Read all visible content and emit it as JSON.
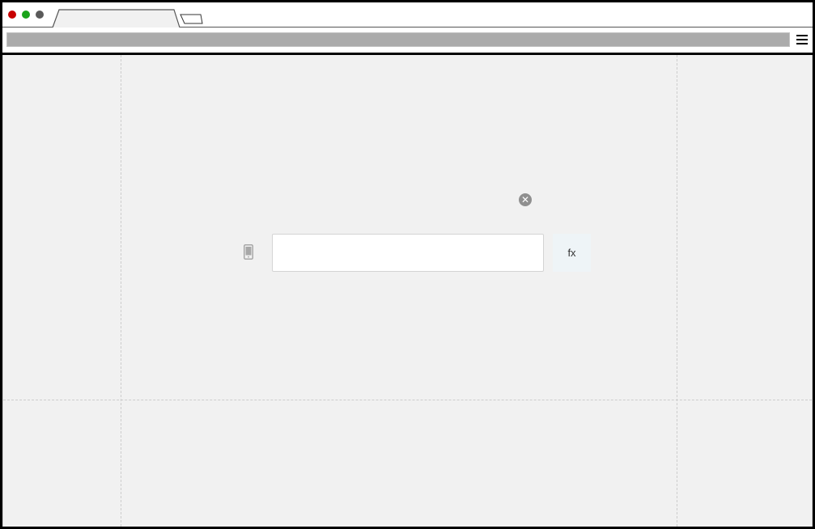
{
  "browser": {
    "active_tab_label": "",
    "new_tab_label": "",
    "address": ""
  },
  "field": {
    "value": "",
    "placeholder": "",
    "leading_icon": "mobile-phone-icon",
    "clear_icon": "close-circle-icon",
    "fx_label": "fx"
  },
  "colors": {
    "window_close": "#c80000",
    "window_maximize": "#1aa31a",
    "window_minimize": "#5a5a5a",
    "canvas_background": "#f1f1f1",
    "fx_button_background": "#eef4f7"
  }
}
